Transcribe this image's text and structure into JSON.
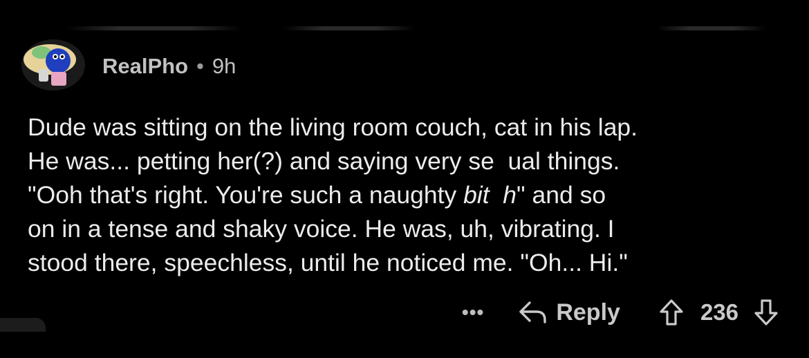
{
  "comment": {
    "author": "RealPho",
    "separator": "•",
    "age": "9h",
    "body_lines": [
      [
        "Dude was sitting on the living room couch, cat in his lap."
      ],
      [
        "He was... petting her(?) and saying very se  ual things."
      ],
      [
        "\"Ooh that's right. You're such a naughty ",
        {
          "italic": "bit  h"
        },
        "\" and so"
      ],
      [
        "on in a tense and shaky voice. He was, uh, vibrating. I"
      ],
      [
        "stood there, speechless, until he noticed me. \"Oh... Hi.\""
      ]
    ]
  },
  "actions": {
    "more_label": "•••",
    "reply_label": "Reply",
    "vote_count": "236"
  },
  "icons": {
    "avatar": "avatar-icon",
    "more": "more-icon",
    "reply": "reply-arrow-icon",
    "upvote": "upvote-arrow-icon",
    "downvote": "downvote-arrow-icon"
  },
  "colors": {
    "background": "#000000",
    "text": "#ececec",
    "meta": "#c2c2c2"
  }
}
